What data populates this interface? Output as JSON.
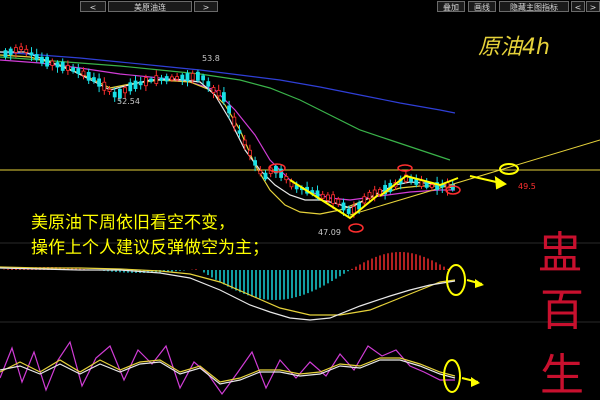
{
  "toolbar": {
    "prev": "<",
    "symbol": "美原油连",
    "next": ">",
    "overlay": "叠加",
    "draw_line": "画线",
    "hide_indicator": "隐藏主图指标",
    "nav_left": "<",
    "nav_right": ">"
  },
  "chart_labels": {
    "title": "原油4h",
    "price_high": "53.8",
    "price_mid": "52.54",
    "price_low": "47.09",
    "price_target": "49.5",
    "commentary_line1": "美原油下周依旧看空不变，",
    "commentary_line2": "操作上个人建议反弹做空为主；",
    "watermark": [
      "盅",
      "百",
      "生"
    ]
  },
  "colors": {
    "background": "#000000",
    "up_candle": "#ff2f2f",
    "down_candle": "#19e0e6",
    "ma_white": "#e8e8e8",
    "ma_yellow": "#e6d23a",
    "ma_magenta": "#d13cd6",
    "ma_green": "#3ab34a",
    "ma_blue": "#2f3fd6",
    "annotation": "#ffff00",
    "commentary": "#ffff00",
    "watermark": "#c8102e",
    "price_label": "#c8c8c8",
    "target_label": "#ff3030"
  },
  "icons": [
    "circle-marker",
    "arrow-marker",
    "trendline"
  ]
}
